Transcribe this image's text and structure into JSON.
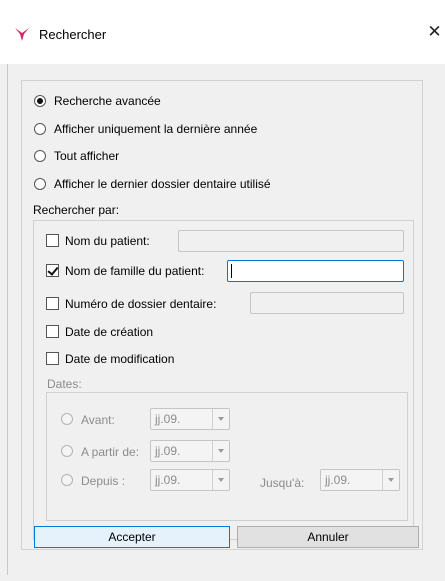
{
  "window": {
    "title": "Rechercher",
    "close_label": "✕"
  },
  "search_modes": [
    {
      "label": "Recherche avancée",
      "checked": true
    },
    {
      "label": "Afficher uniquement la dernière année",
      "checked": false
    },
    {
      "label": "Tout afficher",
      "checked": false
    },
    {
      "label": "Afficher le dernier dossier dentaire utilisé",
      "checked": false
    }
  ],
  "search_by": {
    "label": "Rechercher par:",
    "criteria": [
      {
        "label": "Nom du patient:",
        "checked": false,
        "value": ""
      },
      {
        "label": "Nom de famille du patient:",
        "checked": true,
        "value": ""
      },
      {
        "label": "Numéro de dossier dentaire:",
        "checked": false,
        "value": ""
      },
      {
        "label": "Date de création",
        "checked": false
      },
      {
        "label": "Date de modification",
        "checked": false
      }
    ]
  },
  "dates": {
    "label": "Dates:",
    "options": [
      {
        "label": "Avant:",
        "value": "jj.09."
      },
      {
        "label": "A partir de:",
        "value": "jj.09."
      },
      {
        "label": "Depuis :",
        "value": "jj.09."
      }
    ],
    "until_label": "Jusqu'à:",
    "until_value": "jj.09."
  },
  "buttons": {
    "accept": "Accepter",
    "cancel": "Annuler"
  }
}
